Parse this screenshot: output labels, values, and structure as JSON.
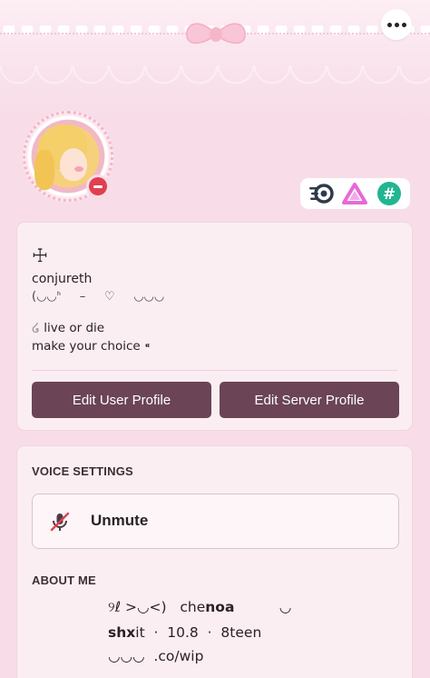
{
  "header": {
    "more_icon": "more-horizontal-icon"
  },
  "profile": {
    "status": "dnd",
    "colors": {
      "accent_button": "#6b4456",
      "dnd": "#e0404f",
      "background": "#f8dde8"
    },
    "badges": [
      "nitro-orbit-badge-icon",
      "triangle-badge-icon",
      "hashtag-badge-icon"
    ],
    "cross_glyph": "☩",
    "username": "conjureth",
    "kaomoji": "(◡◡ᑋ     –     ♡     ◡◡◡",
    "bio_line1": " live or die",
    "bio_line2": "make your choice ⁌",
    "edit_user_label": "Edit User Profile",
    "edit_server_label": "Edit Server Profile"
  },
  "voice": {
    "title": "VOICE SETTINGS",
    "unmute_label": "Unmute"
  },
  "about": {
    "title": "ABOUT ME",
    "line1_a": "୨ℓ >◡<)   che",
    "line1_b": "noa",
    "line1_c": "          ◡",
    "line2_a": "shx",
    "line2_b": "it  ·  10.8  ·  8teen",
    "line3": "◡◡◡  .co/wip"
  }
}
